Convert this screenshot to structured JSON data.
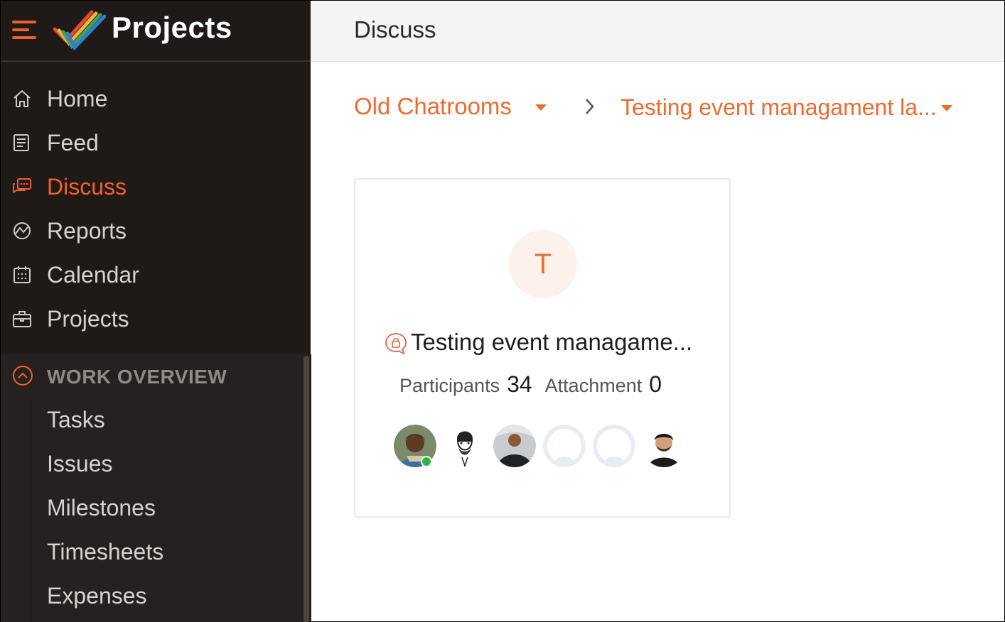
{
  "app": {
    "title": "Projects"
  },
  "sidebar": {
    "items": [
      {
        "label": "Home",
        "icon": "home-icon"
      },
      {
        "label": "Feed",
        "icon": "feed-icon"
      },
      {
        "label": "Discuss",
        "icon": "discuss-icon",
        "active": true
      },
      {
        "label": "Reports",
        "icon": "reports-icon"
      },
      {
        "label": "Calendar",
        "icon": "calendar-icon"
      },
      {
        "label": "Projects",
        "icon": "briefcase-icon"
      }
    ],
    "work_overview": {
      "label": "WORK OVERVIEW",
      "icon": "chevron-up-circle-icon",
      "items": [
        "Tasks",
        "Issues",
        "Milestones",
        "Timesheets",
        "Expenses"
      ]
    }
  },
  "main": {
    "title": "Discuss",
    "breadcrumb": {
      "first": "Old Chatrooms",
      "second": "Testing event managament la..."
    },
    "card": {
      "avatar_letter": "T",
      "title": "Testing event managame...",
      "participants_label": "Participants",
      "participants_count": "34",
      "attachment_label": "Attachment",
      "attachment_count": "0"
    }
  },
  "colors": {
    "accent": "#ef6a2e",
    "sidebar_bg": "#1f1a17",
    "online": "#2ab745"
  }
}
